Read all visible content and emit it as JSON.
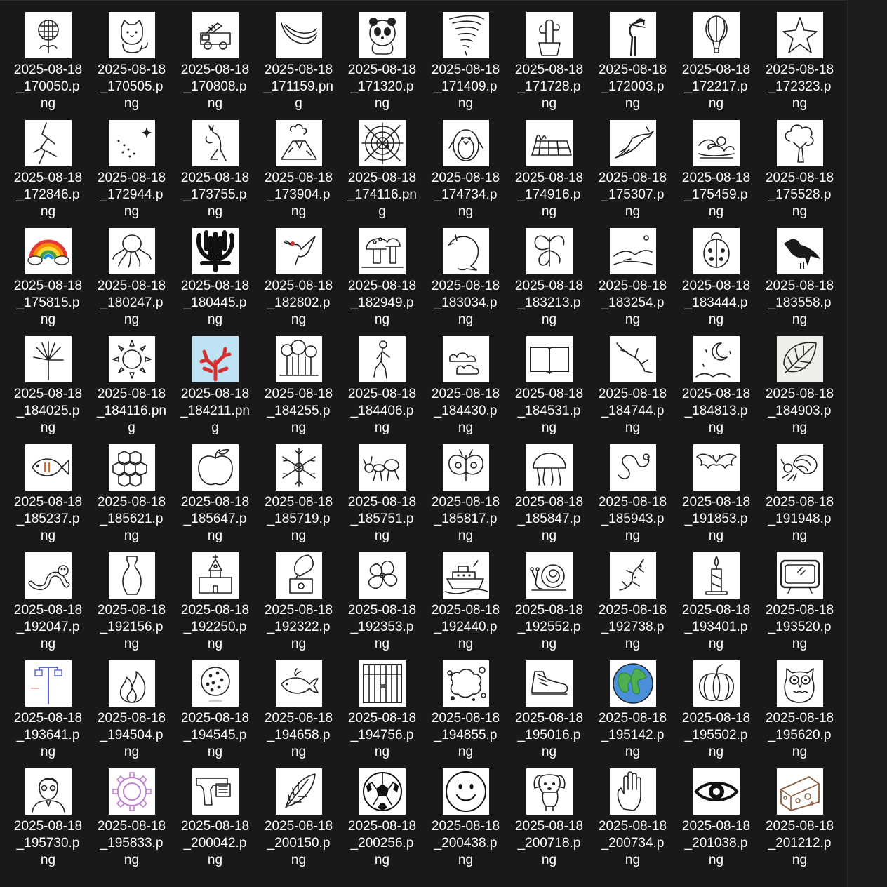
{
  "files": [
    {
      "name": "2025-08-18_170050.png",
      "icon": "flower-icon"
    },
    {
      "name": "2025-08-18_170505.png",
      "icon": "cat-icon"
    },
    {
      "name": "2025-08-18_170808.png",
      "icon": "fire-truck-icon"
    },
    {
      "name": "2025-08-18_171159.png",
      "icon": "bananas-icon"
    },
    {
      "name": "2025-08-18_171320.png",
      "icon": "panda-icon"
    },
    {
      "name": "2025-08-18_171409.png",
      "icon": "tornado-icon"
    },
    {
      "name": "2025-08-18_171728.png",
      "icon": "cactus-icon"
    },
    {
      "name": "2025-08-18_172003.png",
      "icon": "heron-icon"
    },
    {
      "name": "2025-08-18_172217.png",
      "icon": "hot-air-balloon-icon"
    },
    {
      "name": "2025-08-18_172323.png",
      "icon": "starfish-icon"
    },
    {
      "name": "2025-08-18_172846.png",
      "icon": "lightning-icon"
    },
    {
      "name": "2025-08-18_172944.png",
      "icon": "constellation-icon"
    },
    {
      "name": "2025-08-18_173755.png",
      "icon": "kangaroo-icon"
    },
    {
      "name": "2025-08-18_173904.png",
      "icon": "volcano-icon"
    },
    {
      "name": "2025-08-18_174116.png",
      "icon": "spider-web-icon"
    },
    {
      "name": "2025-08-18_174734.png",
      "icon": "penguin-icon"
    },
    {
      "name": "2025-08-18_174916.png",
      "icon": "field-icon"
    },
    {
      "name": "2025-08-18_175307.png",
      "icon": "eagle-icon"
    },
    {
      "name": "2025-08-18_175459.png",
      "icon": "wave-icon"
    },
    {
      "name": "2025-08-18_175528.png",
      "icon": "tree-icon"
    },
    {
      "name": "2025-08-18_175815.png",
      "icon": "rainbow-icon"
    },
    {
      "name": "2025-08-18_180247.png",
      "icon": "octopus-icon"
    },
    {
      "name": "2025-08-18_180445.png",
      "icon": "coral-black-icon"
    },
    {
      "name": "2025-08-18_182802.png",
      "icon": "hummingbird-icon"
    },
    {
      "name": "2025-08-18_182949.png",
      "icon": "mushroom-icon"
    },
    {
      "name": "2025-08-18_183034.png",
      "icon": "dolphin-icon"
    },
    {
      "name": "2025-08-18_183213.png",
      "icon": "butterfly-icon"
    },
    {
      "name": "2025-08-18_183254.png",
      "icon": "dunes-icon"
    },
    {
      "name": "2025-08-18_183444.png",
      "icon": "ladybug-icon"
    },
    {
      "name": "2025-08-18_183558.png",
      "icon": "crow-icon"
    },
    {
      "name": "2025-08-18_184025.png",
      "icon": "dandelion-icon"
    },
    {
      "name": "2025-08-18_184116.png",
      "icon": "sun-icon"
    },
    {
      "name": "2025-08-18_184211.png",
      "icon": "coral-red-icon"
    },
    {
      "name": "2025-08-18_184255.png",
      "icon": "forest-icon"
    },
    {
      "name": "2025-08-18_184406.png",
      "icon": "walking-person-icon"
    },
    {
      "name": "2025-08-18_184430.png",
      "icon": "clouds-icon"
    },
    {
      "name": "2025-08-18_184531.png",
      "icon": "book-icon"
    },
    {
      "name": "2025-08-18_184744.png",
      "icon": "branch-icon"
    },
    {
      "name": "2025-08-18_184813.png",
      "icon": "moon-night-icon"
    },
    {
      "name": "2025-08-18_184903.png",
      "icon": "leaf-icon"
    },
    {
      "name": "2025-08-18_185237.png",
      "icon": "fish-icon"
    },
    {
      "name": "2025-08-18_185621.png",
      "icon": "honeycomb-icon"
    },
    {
      "name": "2025-08-18_185647.png",
      "icon": "apple-icon"
    },
    {
      "name": "2025-08-18_185719.png",
      "icon": "snowflake-icon"
    },
    {
      "name": "2025-08-18_185751.png",
      "icon": "ant-icon"
    },
    {
      "name": "2025-08-18_185817.png",
      "icon": "moth-icon"
    },
    {
      "name": "2025-08-18_185847.png",
      "icon": "jellyfish-icon"
    },
    {
      "name": "2025-08-18_185943.png",
      "icon": "snake-icon"
    },
    {
      "name": "2025-08-18_191853.png",
      "icon": "bat-icon"
    },
    {
      "name": "2025-08-18_191948.png",
      "icon": "hermit-crab-icon"
    },
    {
      "name": "2025-08-18_192047.png",
      "icon": "worm-icon"
    },
    {
      "name": "2025-08-18_192156.png",
      "icon": "vase-icon"
    },
    {
      "name": "2025-08-18_192250.png",
      "icon": "church-icon"
    },
    {
      "name": "2025-08-18_192322.png",
      "icon": "gramophone-icon"
    },
    {
      "name": "2025-08-18_192353.png",
      "icon": "hibiscus-icon"
    },
    {
      "name": "2025-08-18_192440.png",
      "icon": "ship-icon"
    },
    {
      "name": "2025-08-18_192552.png",
      "icon": "snail-icon"
    },
    {
      "name": "2025-08-18_192738.png",
      "icon": "lizard-icon"
    },
    {
      "name": "2025-08-18_193401.png",
      "icon": "candle-icon"
    },
    {
      "name": "2025-08-18_193520.png",
      "icon": "tv-icon"
    },
    {
      "name": "2025-08-18_193641.png",
      "icon": "street-lamp-icon"
    },
    {
      "name": "2025-08-18_194504.png",
      "icon": "fire-icon"
    },
    {
      "name": "2025-08-18_194545.png",
      "icon": "disco-ball-icon"
    },
    {
      "name": "2025-08-18_194658.png",
      "icon": "whale-icon"
    },
    {
      "name": "2025-08-18_194756.png",
      "icon": "cage-icon"
    },
    {
      "name": "2025-08-18_194855.png",
      "icon": "bubbles-icon"
    },
    {
      "name": "2025-08-18_195016.png",
      "icon": "sneaker-icon"
    },
    {
      "name": "2025-08-18_195142.png",
      "icon": "earth-icon"
    },
    {
      "name": "2025-08-18_195502.png",
      "icon": "pumpkin-icon"
    },
    {
      "name": "2025-08-18_195620.png",
      "icon": "owl-icon"
    },
    {
      "name": "2025-08-18_195730.png",
      "icon": "man-portrait-icon"
    },
    {
      "name": "2025-08-18_195833.png",
      "icon": "gear-icon"
    },
    {
      "name": "2025-08-18_200042.png",
      "icon": "gun-icon"
    },
    {
      "name": "2025-08-18_200150.png",
      "icon": "feather-icon"
    },
    {
      "name": "2025-08-18_200256.png",
      "icon": "soccer-ball-icon"
    },
    {
      "name": "2025-08-18_200438.png",
      "icon": "smiley-icon"
    },
    {
      "name": "2025-08-18_200718.png",
      "icon": "puppy-icon"
    },
    {
      "name": "2025-08-18_200734.png",
      "icon": "hand-icon"
    },
    {
      "name": "2025-08-18_201038.png",
      "icon": "eye-icon"
    },
    {
      "name": "2025-08-18_201212.png",
      "icon": "cheese-icon"
    }
  ]
}
